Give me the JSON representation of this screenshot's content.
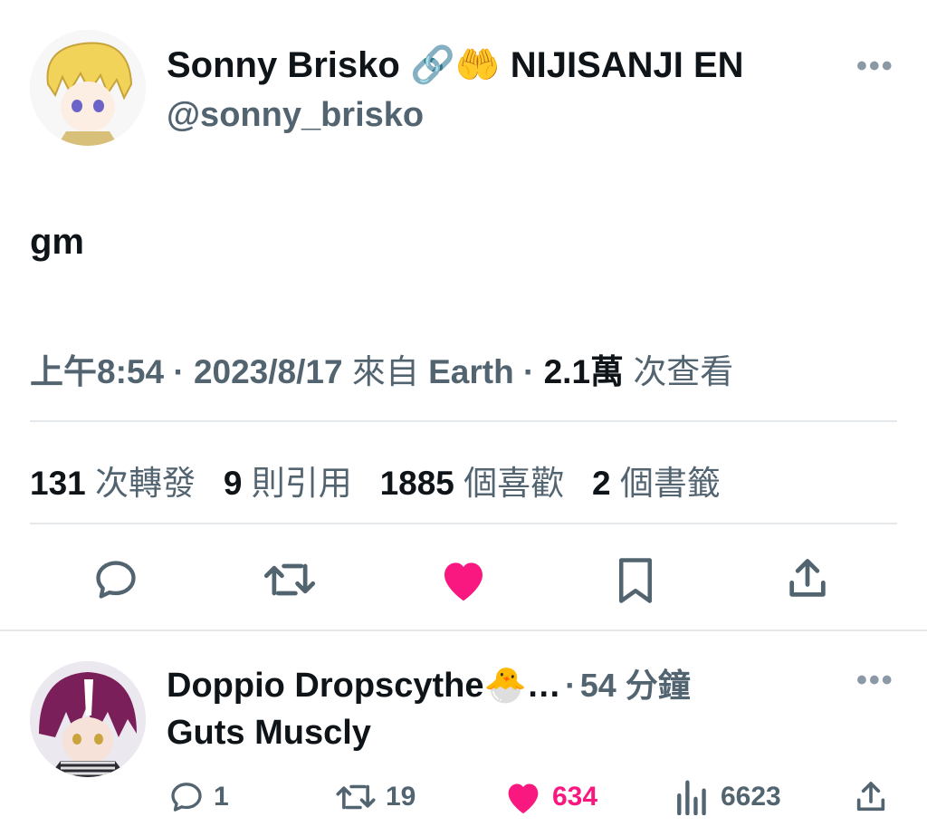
{
  "tweet": {
    "author_name": "Sonny Brisko",
    "author_badges": [
      "🔗",
      "🤲"
    ],
    "author_suffix": "NIJISANJI EN",
    "author_handle": "@sonny_brisko",
    "more_label": "•••",
    "text": "gm",
    "meta": {
      "time": "上午8:54",
      "sep1": "·",
      "date": "2023/8/17",
      "from_label": "來自",
      "source": "Earth",
      "sep2": "·",
      "views_count": "2.1萬",
      "views_label": "次查看"
    },
    "stats": {
      "retweets_count": "131",
      "retweets_label": "次轉發",
      "quotes_count": "9",
      "quotes_label": "則引用",
      "likes_count": "1885",
      "likes_label": "個喜歡",
      "bookmarks_count": "2",
      "bookmarks_label": "個書籤"
    },
    "actions": [
      "reply-icon",
      "retweet-icon",
      "like-icon",
      "bookmark-icon",
      "share-icon"
    ],
    "liked": true
  },
  "reply": {
    "author_name": "Doppio Dropscythe🐣…",
    "sep": "·",
    "time": "54 分鐘",
    "more_label": "•••",
    "text": "Guts Muscly",
    "reply_count": "1",
    "retweet_count": "19",
    "like_count": "634",
    "view_count": "6623"
  },
  "colors": {
    "like": "#f91880",
    "secondary_text": "#536471",
    "primary_text": "#0f1419",
    "divider": "#e6e9eb"
  }
}
